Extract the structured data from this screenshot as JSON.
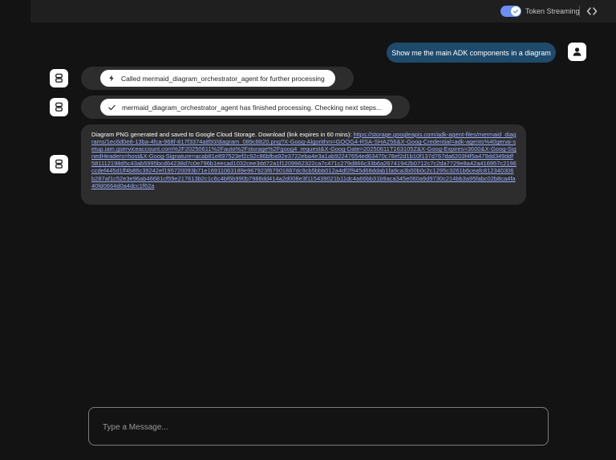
{
  "header": {
    "token_streaming_label": "Token Streaming",
    "token_streaming_enabled": true,
    "toggle_color": "#6b8ef5"
  },
  "messages": {
    "user_message": "Show me the main ADK components in a diagram",
    "event_1": "Called mermaid_diagram_orchestrator_agent for further processing",
    "event_2": "mermaid_diagram_orchestrator_agent has finished processing. Checking next steps...",
    "bot_text": "Diagram PNG generated and saved to Google Cloud Storage. Download (link expires in 60 mins): ",
    "bot_link": "https://storage.googleapis.com/adk-agent-files/mermaid_diagrams/1ec6d0e8-13ba-4fca-968f-817f3374a850/diagram_089c8820.png?X-Goog-Algorithm=GOOG4-RSA-SHA256&X-Goog-Credential=adk-agents%40genai-setup.iam.gserviceaccount.com%2F20250611%2Fauto%2Fstorage%2Fgoog4_request&X-Goog-Date=20250611T163105Z&X-Goog-Expires=3600&X-Goog-SignedHeaders=host&X-Goog-Signature=acab81e897523ef2c92c86bfba92e3722eba4e3a1ab92247654ed63470c78ef2d1b10f137d767da6203f4f5a479dd349ddf581112198d5c43ab5995bcd64238d7c0e796b1eecad1032cee3dd72a1f1209962322ca7c471c279d866c33b6a26741942b0712c7c2da7729e8a42a416957c2196ccdef445d1ff4b86c39242ef195720093b71e16911063189e967923f67901887dc9cb5bbb012a4df2f945d68ddab1fa9ca3b00b0c2c1295c3261b6ceafc812340306b287af1c52e3e96ab46681cf59e217613b2c1c6c4bf6b990b7988dd414a2d008e3f115439021b11dc4a66bb31b9aca345e060a9d9730c214bb3a95fabc02b8ca4fa40fd0664d0a4dcc1f62a",
    "bot_text_color": "#ffffff",
    "link_color": "#9ab0ff"
  },
  "icons": {
    "user_avatar": "person-icon",
    "bot_avatar": "robot-icon",
    "event_1_icon": "bolt-icon",
    "event_2_icon": "check-icon",
    "code_toggle": "code-icon"
  },
  "composer": {
    "placeholder": "Type a Message..."
  }
}
